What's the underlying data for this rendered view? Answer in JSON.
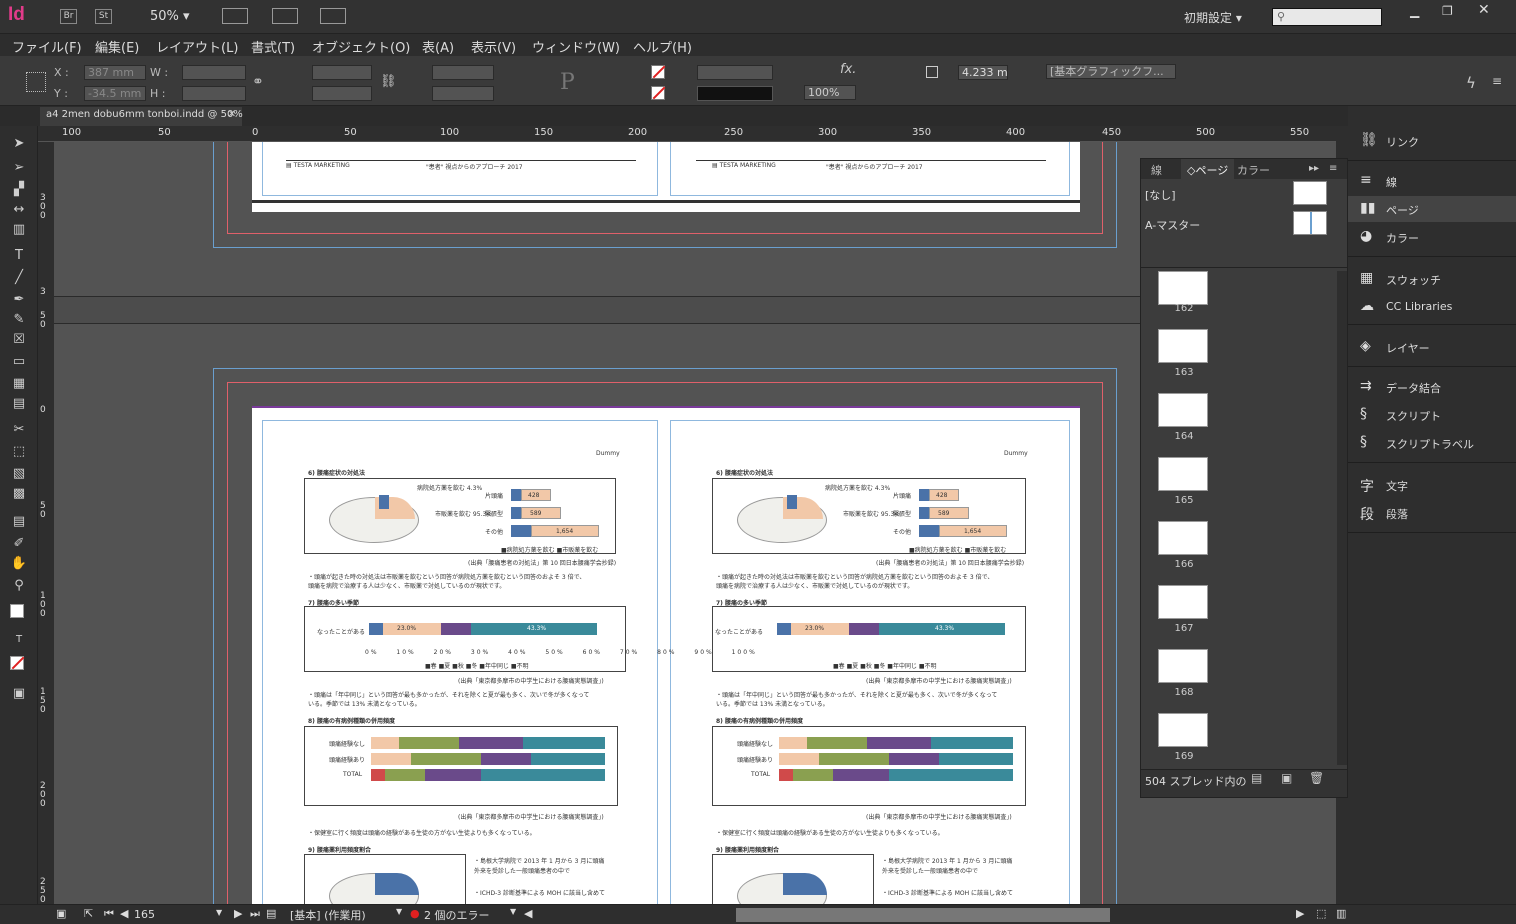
{
  "app": {
    "logo": "Id",
    "bridge_btn": "Br",
    "stock_btn": "St",
    "zoom": "50%",
    "workspace": "初期設定",
    "search_placeholder": ""
  },
  "menu": [
    "ファイル(F)",
    "編集(E)",
    "レイアウト(L)",
    "書式(T)",
    "オブジェクト(O)",
    "表(A)",
    "表示(V)",
    "ウィンドウ(W)",
    "ヘルプ(H)"
  ],
  "control": {
    "x_label": "X :",
    "y_label": "Y :",
    "w_label": "W :",
    "h_label": "H :",
    "x": "387 mm",
    "y": "-34.5 mm",
    "stroke_weight": "4.233 mm",
    "opacity": "100%",
    "object_style": "[基本グラフィックフ..."
  },
  "document_tab": "a4 2men dobu6mm tonboi.indd @ 50%",
  "ruler": {
    "h_ticks": [
      "100",
      "50",
      "0",
      "50",
      "100",
      "150",
      "200",
      "250",
      "300",
      "350",
      "400",
      "450",
      "500",
      "550"
    ],
    "v_ticks": [
      "3 0 0",
      "3",
      "5 0",
      "0",
      "5 0",
      "1 0 0",
      "1 5 0",
      "2 0 0",
      "2 5 0"
    ]
  },
  "document": {
    "footer_left": "▤ TESTA MARKETING",
    "footer_right": "\"患者\" 視点からのアプローチ 2017",
    "header_tag": "Dummy",
    "sections": [
      {
        "title": "6) 腰痛症状の対処法",
        "legend": "■病院処方薬を飲む   ■市販薬を飲む",
        "source": "(出典「腰痛患者の対処法」第 10 回日本腰痛学会抄録)"
      },
      {
        "title": "7) 腰痛の多い季節",
        "source": "(出典「東京都多摩市の中学生における腰痛実態調査」)"
      },
      {
        "title": "8) 腰痛の有病例種類の併用頻度",
        "source": "(出典「東京都多摩市の中学生における腰痛実態調査」)"
      },
      {
        "title": "9) 腰痛薬利用頻度割合"
      }
    ],
    "bar_labels": [
      "片頭痛",
      "緊張型",
      "その他"
    ],
    "bar_values": [
      "428",
      "589",
      "1,654"
    ],
    "season_label": "なったことがある",
    "season_values": [
      "23.0%",
      "43.3%"
    ],
    "season_axis": [
      "0%",
      "10%",
      "20%",
      "30%",
      "40%",
      "50%",
      "60%",
      "70%",
      "80%",
      "90%",
      "100%"
    ],
    "season_legend": "■春  ■夏  ■秋  ■冬  ■年中同じ  ■不明",
    "combo_labels": [
      "頭痛経験なし",
      "頭痛経験あり",
      "TOTAL"
    ],
    "pie_labels": [
      "病院処方薬を飲む 4.3%",
      "市販薬を飲む 95.3%"
    ],
    "body_lines": [
      "・頭痛が起きた時の対処法は市販薬を飲むという回答が病院処方薬を飲むという回答のおよそ 3 倍で、",
      "  頭痛を病院で治療する人は少なく、市販薬で対処しているのが現状です。",
      "・頭痛は「年中同じ」という回答が最も多かったが、それを除くと夏が最も多く、次いで冬が多くなって",
      "  いる。季節では 13% 未満となっている。",
      "・保健室に行く頻度は頭痛の経験がある生徒の方がない生徒よりも多くなっている。",
      "・島根大学病院で 2013 年 1 月から 3 月に頭痛",
      "  外来を受診した一般頭痛患者の中で",
      "・ICHD-3 診断基準による MOH に該当し含めて"
    ]
  },
  "pages_panel": {
    "tabs": [
      "線",
      "ページ",
      "カラー"
    ],
    "masters": [
      "[なし]",
      "A-マスター"
    ],
    "thumb_pages": [
      "162",
      "163",
      "164",
      "165",
      "166",
      "167",
      "168",
      "169"
    ],
    "footer": "504 スプレッド内の"
  },
  "dock": {
    "items": [
      {
        "icon": "link-icon",
        "label": "リンク"
      },
      {
        "icon": "stroke-icon",
        "label": "線"
      },
      {
        "icon": "pages-icon",
        "label": "ページ"
      },
      {
        "icon": "color-icon",
        "label": "カラー"
      },
      {
        "icon": "swatches-icon",
        "label": "スウォッチ"
      },
      {
        "icon": "cc-libraries-icon",
        "label": "CC Libraries"
      },
      {
        "icon": "layers-icon",
        "label": "レイヤー"
      },
      {
        "icon": "data-merge-icon",
        "label": "データ結合"
      },
      {
        "icon": "script-icon",
        "label": "スクリプト"
      },
      {
        "icon": "script-label-icon",
        "label": "スクリプトラベル"
      },
      {
        "icon": "character-icon",
        "label": "文字"
      },
      {
        "icon": "paragraph-icon",
        "label": "段落"
      }
    ]
  },
  "status": {
    "page": "165",
    "master": "[基本] (作業用)",
    "errors": "2 個のエラー"
  }
}
